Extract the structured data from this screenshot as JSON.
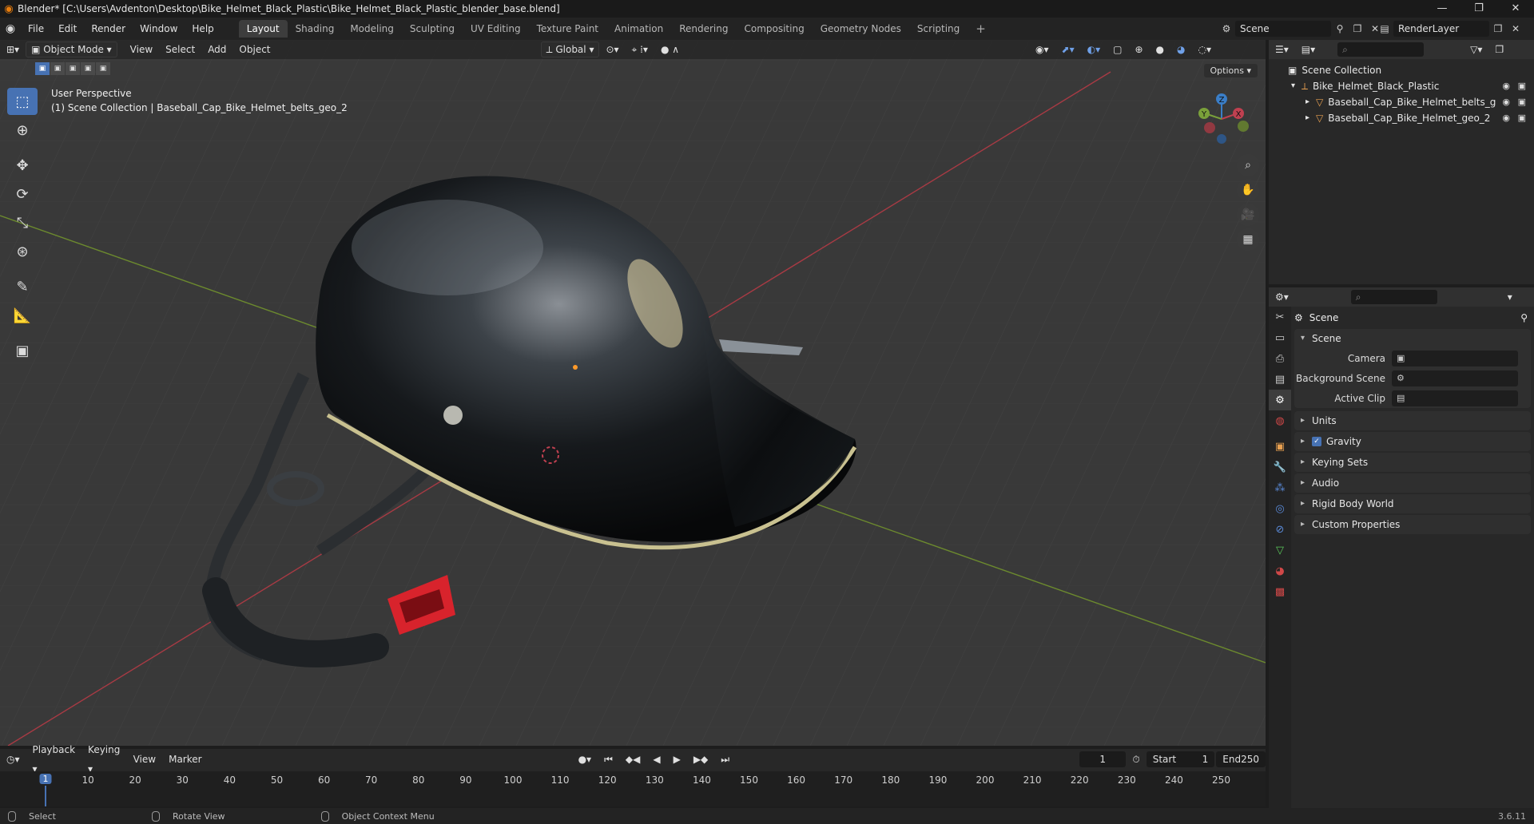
{
  "window": {
    "title": "Blender* [C:\\Users\\Avdenton\\Desktop\\Bike_Helmet_Black_Plastic\\Bike_Helmet_Black_Plastic_blender_base.blend]",
    "minimize": "—",
    "restore": "❐",
    "close": "✕"
  },
  "menu": [
    "File",
    "Edit",
    "Render",
    "Window",
    "Help"
  ],
  "workspaces": [
    "Layout",
    "Shading",
    "Modeling",
    "Sculpting",
    "UV Editing",
    "Texture Paint",
    "Animation",
    "Rendering",
    "Compositing",
    "Geometry Nodes",
    "Scripting"
  ],
  "active_workspace": "Layout",
  "scene_selector": "Scene",
  "renderlayer_selector": "RenderLayer",
  "viewport": {
    "mode": "Object Mode",
    "menus": [
      "View",
      "Select",
      "Add",
      "Object"
    ],
    "transform_orientation": "Global",
    "options": "Options",
    "perspective": "User Perspective",
    "collection_info": "(1) Scene Collection | Baseball_Cap_Bike_Helmet_belts_geo_2",
    "gizmo": {
      "x": "X",
      "y": "Y",
      "z": "Z"
    }
  },
  "outliner": {
    "root": "Scene Collection",
    "items": [
      {
        "label": "Bike_Helmet_Black_Plastic"
      },
      {
        "label": "Baseball_Cap_Bike_Helmet_belts_g"
      },
      {
        "label": "Baseball_Cap_Bike_Helmet_geo_2"
      }
    ]
  },
  "properties": {
    "context": "Scene",
    "section": "Scene",
    "fields": [
      {
        "label": "Camera"
      },
      {
        "label": "Background Scene"
      },
      {
        "label": "Active Clip"
      }
    ],
    "panels": [
      "Units",
      "Gravity",
      "Keying Sets",
      "Audio",
      "Rigid Body World",
      "Custom Properties"
    ]
  },
  "timeline": {
    "menus": [
      "Playback",
      "Keying",
      "View",
      "Marker"
    ],
    "current_frame": "1",
    "start_label": "Start",
    "start": "1",
    "end_label": "End",
    "end": "250",
    "ticks": [
      "10",
      "20",
      "30",
      "40",
      "50",
      "60",
      "70",
      "80",
      "90",
      "100",
      "110",
      "120",
      "130",
      "140",
      "150",
      "160",
      "170",
      "180",
      "190",
      "200",
      "210",
      "220",
      "230",
      "240",
      "250"
    ]
  },
  "statusbar": {
    "select": "Select",
    "rotate": "Rotate View",
    "context_menu": "Object Context Menu",
    "version": "3.6.11"
  },
  "colors": {
    "accent": "#4772b3",
    "x_axis": "#c04050",
    "y_axis": "#7aa03a",
    "z_axis": "#3a7ec8",
    "buckle": "#d8232c"
  }
}
